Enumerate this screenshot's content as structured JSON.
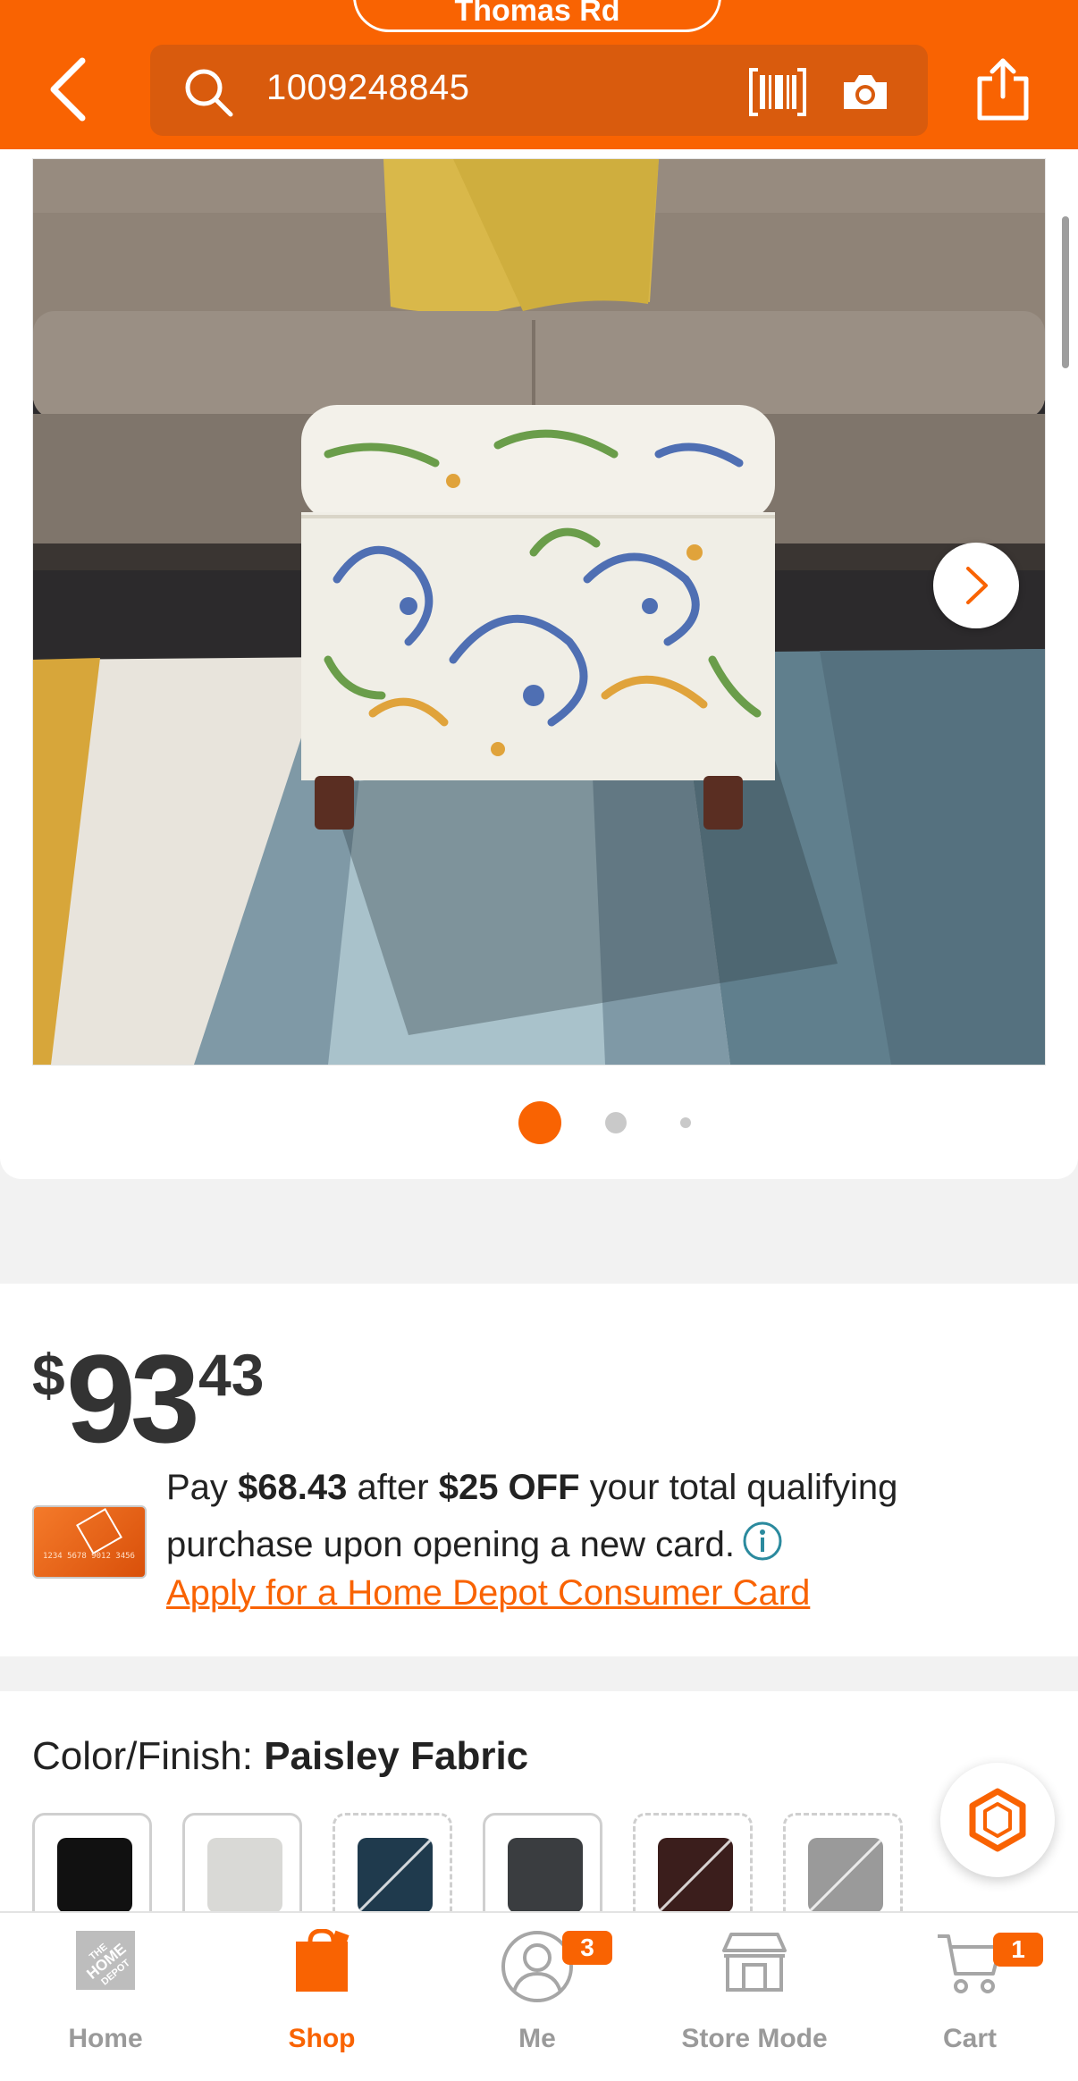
{
  "header": {
    "store_label": "Thomas Rd",
    "search_value": "1009248845",
    "colors": {
      "brand": "#f96302",
      "search_bg": "#d95b0d"
    }
  },
  "gallery": {
    "dot_count": 3,
    "active_dot": 1
  },
  "price": {
    "currency": "$",
    "dollars": "93",
    "cents": "43"
  },
  "promo": {
    "pay_prefix": "Pay",
    "pay_amount": "$68.43",
    "after_word": "after",
    "off_amount": "$25 OFF",
    "line_rest": "your total qualifying purchase upon opening a new card.",
    "apply_link": "Apply for a Home Depot Consumer Card"
  },
  "color_finish": {
    "label": "Color/Finish:",
    "selected": "Paisley Fabric",
    "swatches": [
      {
        "name": "black",
        "color": "#111111",
        "available": true
      },
      {
        "name": "white-pattern",
        "color": "#d9d9d6",
        "available": true
      },
      {
        "name": "navy",
        "color": "#1f3a4d",
        "available": false
      },
      {
        "name": "charcoal",
        "color": "#3a3d40",
        "available": true
      },
      {
        "name": "brown",
        "color": "#3b1e1c",
        "available": false
      },
      {
        "name": "gray-pattern",
        "color": "#9a9a9a",
        "available": false
      }
    ]
  },
  "bottom_nav": {
    "items": [
      {
        "label": "Home",
        "icon": "home-depot-logo-icon"
      },
      {
        "label": "Shop",
        "icon": "shopping-bag-icon",
        "active": true
      },
      {
        "label": "Me",
        "icon": "user-icon",
        "badge": "3"
      },
      {
        "label": "Store Mode",
        "icon": "store-icon"
      },
      {
        "label": "Cart",
        "icon": "cart-icon",
        "badge": "1"
      }
    ]
  }
}
